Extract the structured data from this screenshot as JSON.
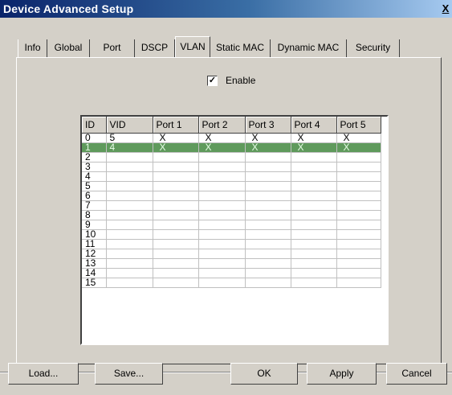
{
  "window": {
    "title": "Device Advanced Setup",
    "close_glyph": "X"
  },
  "tabs": [
    {
      "label": "Info"
    },
    {
      "label": "Global"
    },
    {
      "label": "Port"
    },
    {
      "label": "DSCP"
    },
    {
      "label": "VLAN",
      "active": true
    },
    {
      "label": "Static MAC"
    },
    {
      "label": "Dynamic MAC"
    },
    {
      "label": "Security"
    }
  ],
  "vlan": {
    "enable_label": "Enable",
    "enable_checked": true,
    "check_glyph": "✓",
    "columns": [
      "ID",
      "VID",
      "Port 1",
      "Port 2",
      "Port 3",
      "Port 4",
      "Port 5"
    ],
    "rows": [
      [
        "0",
        "5",
        "X",
        "X",
        "X",
        "X",
        "X"
      ],
      [
        "1",
        "4",
        "X",
        "X",
        "X",
        "X",
        "X"
      ],
      [
        "2",
        "",
        "",
        "",
        "",
        "",
        ""
      ],
      [
        "3",
        "",
        "",
        "",
        "",
        "",
        ""
      ],
      [
        "4",
        "",
        "",
        "",
        "",
        "",
        ""
      ],
      [
        "5",
        "",
        "",
        "",
        "",
        "",
        ""
      ],
      [
        "6",
        "",
        "",
        "",
        "",
        "",
        ""
      ],
      [
        "7",
        "",
        "",
        "",
        "",
        "",
        ""
      ],
      [
        "8",
        "",
        "",
        "",
        "",
        "",
        ""
      ],
      [
        "9",
        "",
        "",
        "",
        "",
        "",
        ""
      ],
      [
        "10",
        "",
        "",
        "",
        "",
        "",
        ""
      ],
      [
        "11",
        "",
        "",
        "",
        "",
        "",
        ""
      ],
      [
        "12",
        "",
        "",
        "",
        "",
        "",
        ""
      ],
      [
        "13",
        "",
        "",
        "",
        "",
        "",
        ""
      ],
      [
        "14",
        "",
        "",
        "",
        "",
        "",
        ""
      ],
      [
        "15",
        "",
        "",
        "",
        "",
        "",
        ""
      ]
    ],
    "selected_row": 1,
    "selected_color": "#5f9a5c"
  },
  "buttons": {
    "load": "Load...",
    "save": "Save...",
    "ok": "OK",
    "apply": "Apply",
    "cancel": "Cancel"
  }
}
